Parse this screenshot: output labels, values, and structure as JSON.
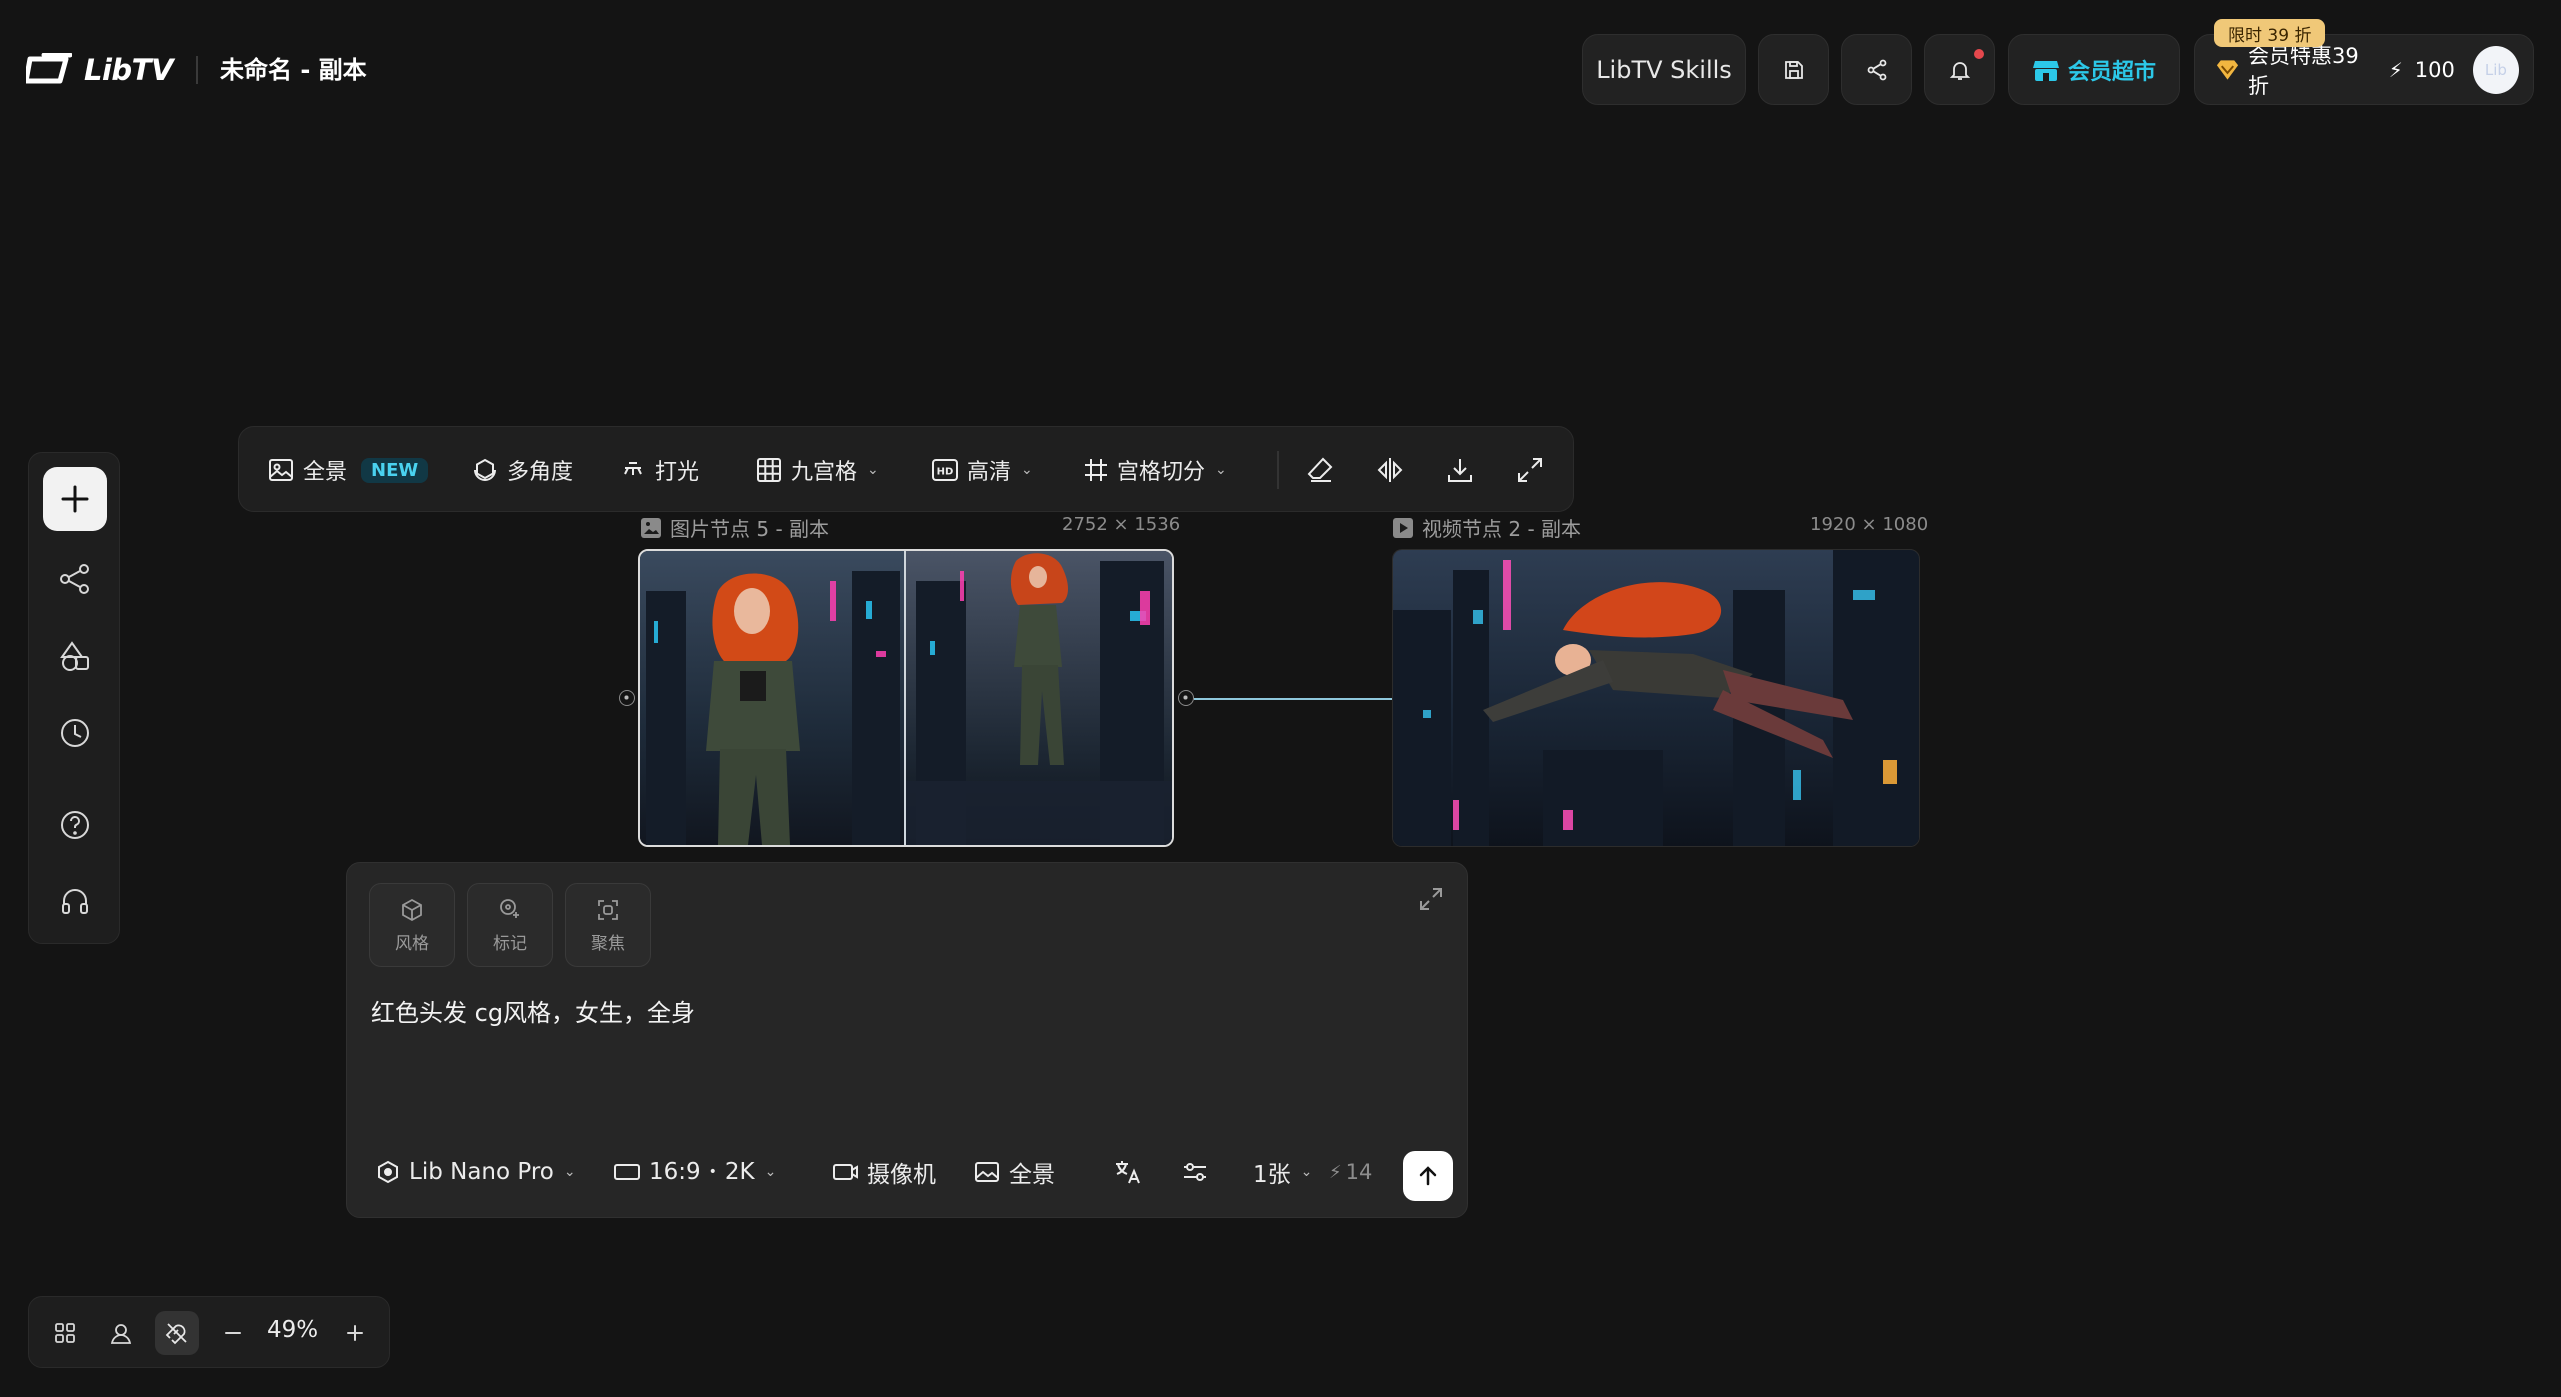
{
  "header": {
    "logo_text": "LibTV",
    "project_title": "未命名 - 副本",
    "skills_label": "LibTV Skills",
    "market_label": "会员超市",
    "vip_tag": "限时 39 折",
    "vip_label": "会员特惠39折",
    "credits": "100",
    "avatar_text": "Lib"
  },
  "sidebar": {
    "items": [
      {
        "icon": "plus-icon"
      },
      {
        "icon": "workflow-icon"
      },
      {
        "icon": "assets-icon"
      },
      {
        "icon": "history-icon"
      },
      {
        "icon": "help-icon"
      },
      {
        "icon": "headset-icon"
      }
    ]
  },
  "toolbar": {
    "panorama": "全景",
    "new_badge": "NEW",
    "multi_angle": "多角度",
    "lighting": "打光",
    "nine_grid": "九宫格",
    "hd": "高清",
    "grid_cut": "宫格切分"
  },
  "nodes": {
    "image": {
      "label": "图片节点 5 - 副本",
      "dims": "2752 × 1536"
    },
    "video": {
      "label": "视频节点 2 - 副本",
      "dims": "1920 × 1080"
    }
  },
  "prompt": {
    "chips": [
      "风格",
      "标记",
      "聚焦"
    ],
    "text": "红色头发 cg风格，女生，全身",
    "model": "Lib Nano Pro",
    "ratio": "16:9",
    "resolution": "2K",
    "camera": "摄像机",
    "panorama": "全景",
    "count": "1张",
    "cost": "14"
  },
  "zoom": {
    "value": "49%"
  }
}
